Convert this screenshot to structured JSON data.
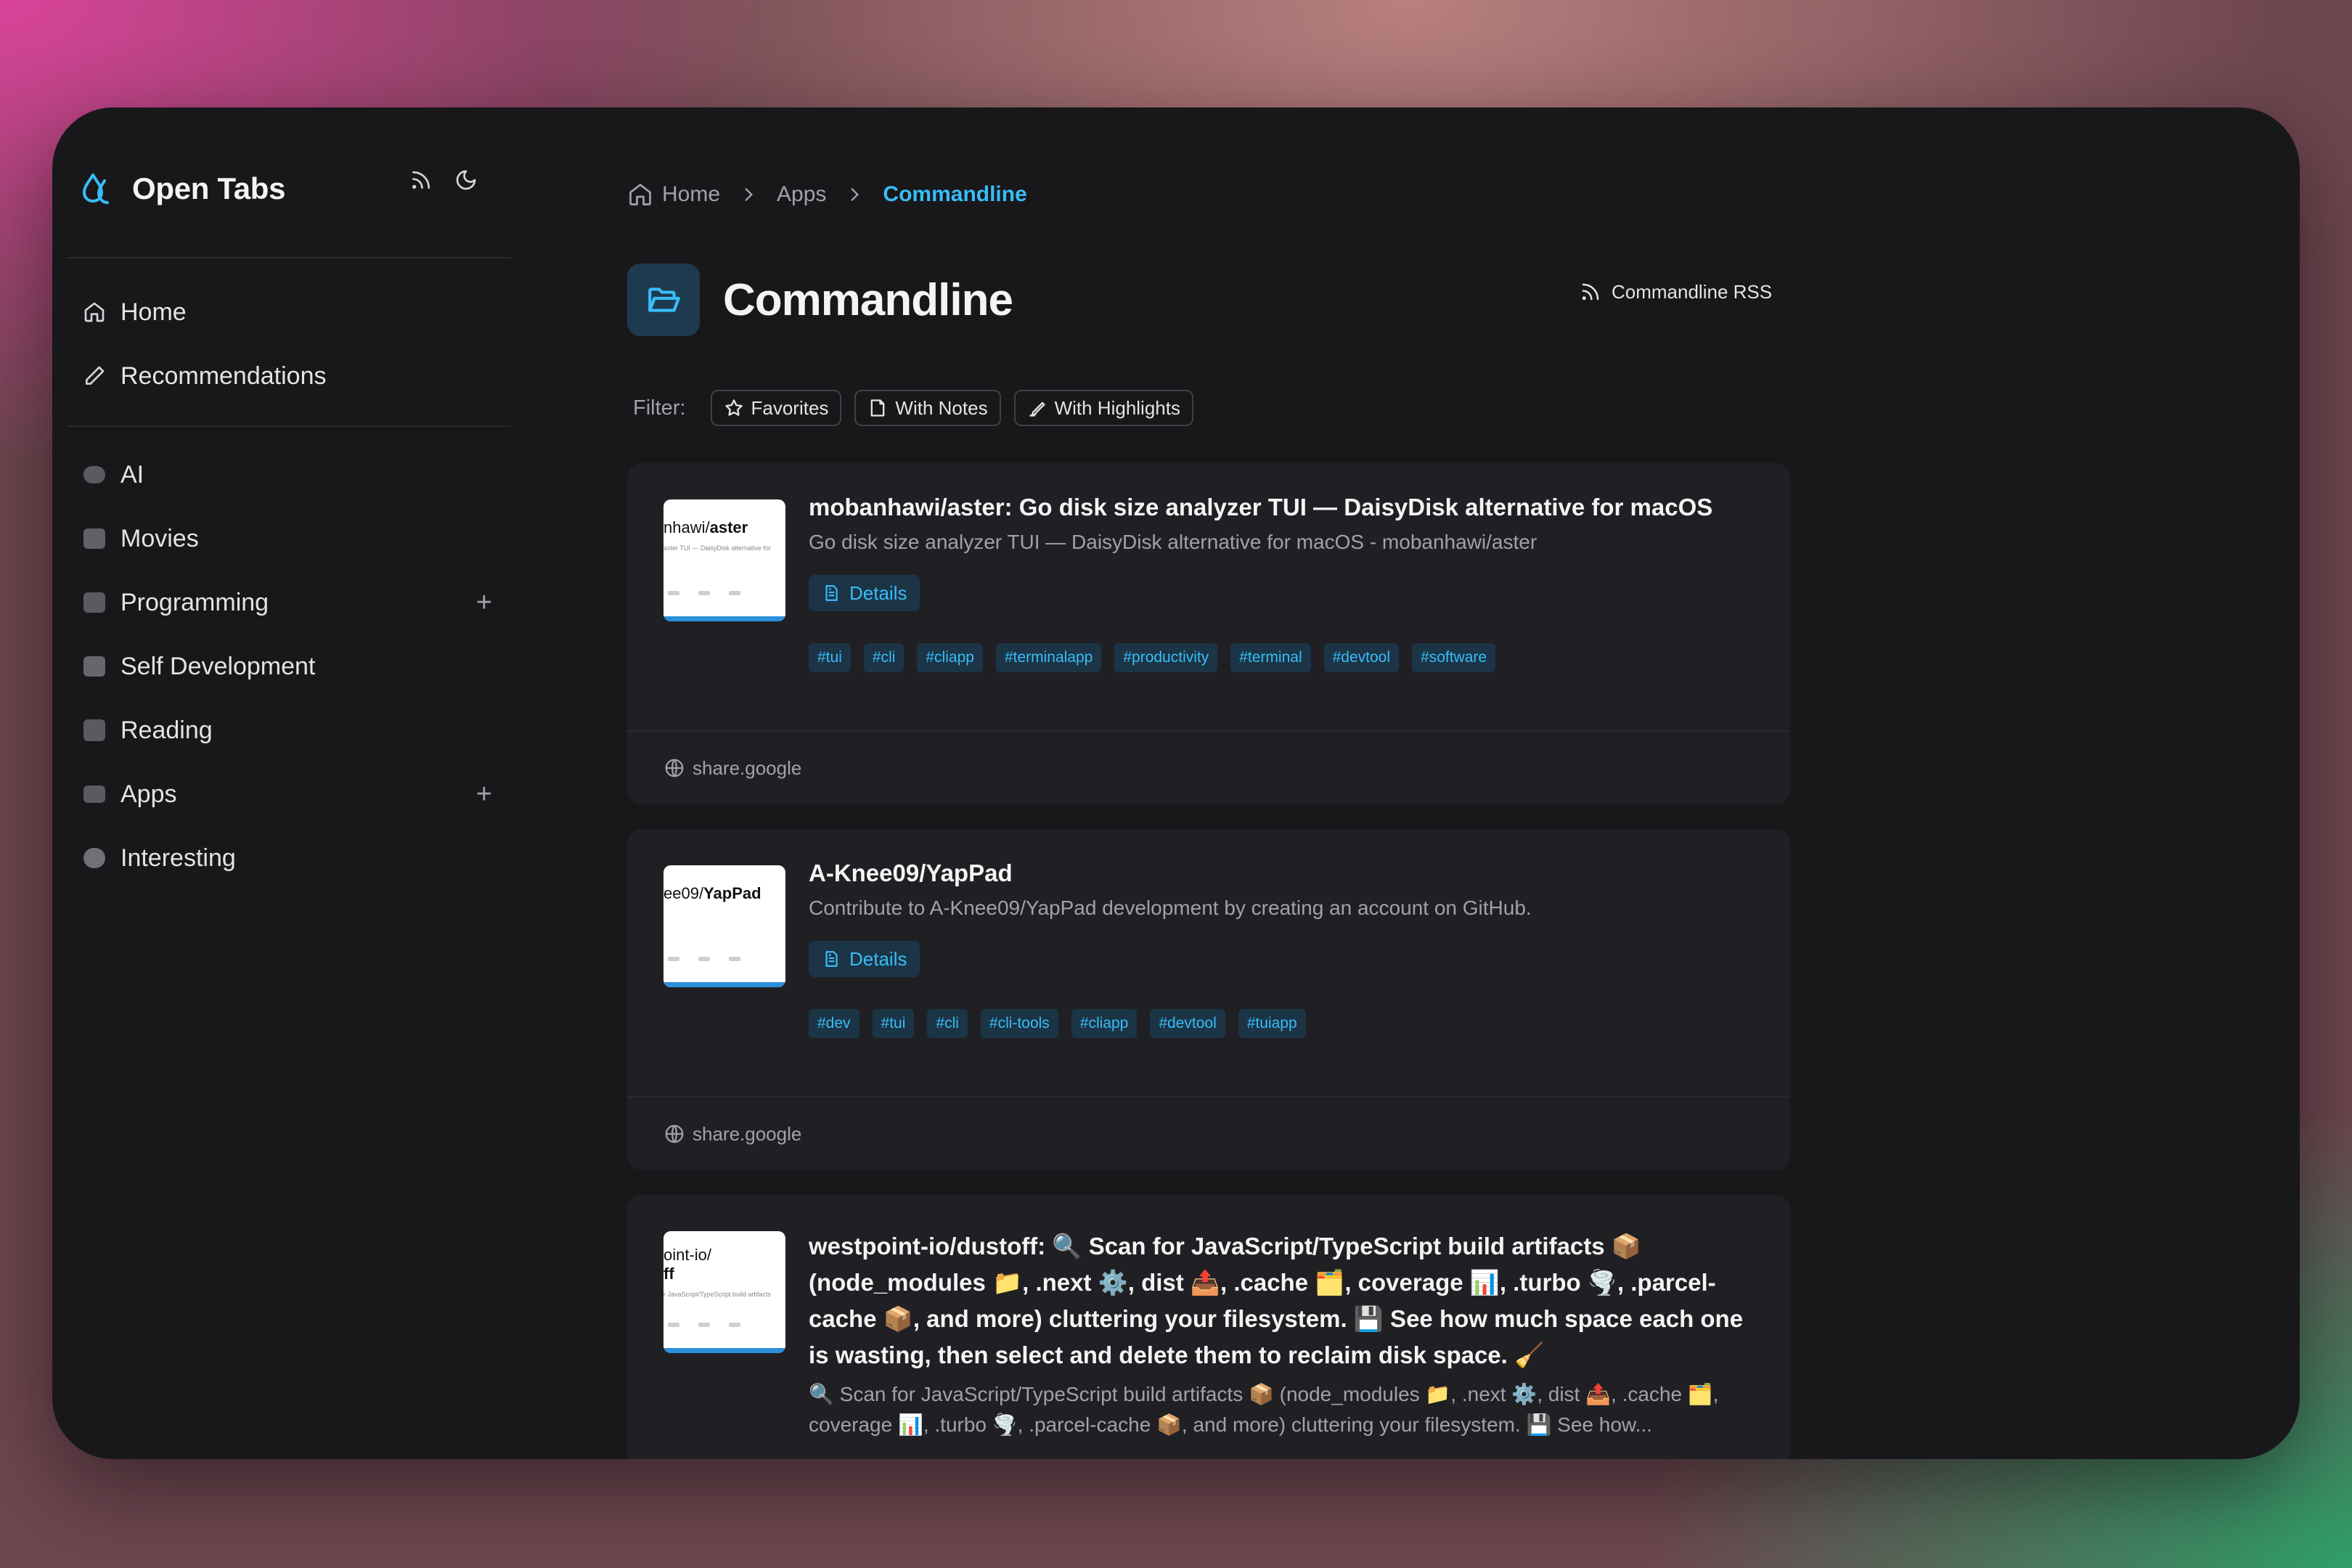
{
  "app": {
    "title": "Open Tabs"
  },
  "sidebar": {
    "primary": [
      {
        "label": "Home",
        "icon": "home-icon"
      },
      {
        "label": "Recommendations",
        "icon": "pen-icon"
      }
    ],
    "categories": [
      {
        "label": "AI",
        "icon": "robot-emoji-icon",
        "expandable": false
      },
      {
        "label": "Movies",
        "icon": "clapper-emoji-icon",
        "expandable": false
      },
      {
        "label": "Programming",
        "icon": "computer-emoji-icon",
        "expandable": true,
        "action": "+"
      },
      {
        "label": "Self Development",
        "icon": "checkbox-emoji-icon",
        "expandable": false
      },
      {
        "label": "Reading",
        "icon": "books-emoji-icon",
        "expandable": false
      },
      {
        "label": "Apps",
        "icon": "monitor-emoji-icon",
        "expandable": true,
        "action": "+"
      },
      {
        "label": "Interesting",
        "icon": "brain-emoji-icon",
        "expandable": false
      }
    ]
  },
  "breadcrumb": {
    "home": "Home",
    "apps": "Apps",
    "current": "Commandline"
  },
  "page": {
    "title": "Commandline",
    "rss_label": "Commandline RSS"
  },
  "filter": {
    "label": "Filter:",
    "chips": [
      "Favorites",
      "With Notes",
      "With Highlights"
    ]
  },
  "cards": [
    {
      "thumb_pre": "nhawi/",
      "thumb_bold": "aster",
      "thumb_line": "aster TUI — DaisyDisk alternative for",
      "title": "mobanhawi/aster: Go disk size analyzer TUI — DaisyDisk alternative for macOS",
      "description": "Go disk size analyzer TUI — DaisyDisk alternative for macOS - mobanhawi/aster",
      "details_label": "Details",
      "tags": [
        "#tui",
        "#cli",
        "#cliapp",
        "#terminalapp",
        "#productivity",
        "#terminal",
        "#devtool",
        "#software"
      ],
      "source": "share.google"
    },
    {
      "thumb_pre": "ee09/",
      "thumb_bold": "YapPad",
      "thumb_line": "",
      "title": "A-Knee09/YapPad",
      "description": "Contribute to A-Knee09/YapPad development by creating an account on GitHub.",
      "details_label": "Details",
      "tags": [
        "#dev",
        "#tui",
        "#cli",
        "#cli-tools",
        "#cliapp",
        "#devtool",
        "#tuiapp"
      ],
      "source": "share.google"
    },
    {
      "thumb_pre": "oint-io/",
      "thumb_bold": "ff",
      "thumb_line": "r JavaScript/TypeScript build artifacts",
      "title": "westpoint-io/dustoff: 🔍 Scan for JavaScript/TypeScript build artifacts 📦 (node_modules 📁, .next ⚙️, dist 📤, .cache 🗂️, coverage 📊, .turbo 🌪️, .parcel-cache 📦, and more) cluttering your filesystem. 💾 See how much space each one is wasting, then select and delete them to reclaim disk space. 🧹",
      "description": "🔍 Scan for JavaScript/TypeScript build artifacts 📦 (node_modules 📁, .next ⚙️, dist 📤, .cache 🗂️, coverage 📊, .turbo 🌪️, .parcel-cache 📦, and more) cluttering your filesystem. 💾 See how..."
    }
  ],
  "colors": {
    "accent": "#38bdf8",
    "background": "#18181b",
    "card": "#202024"
  }
}
